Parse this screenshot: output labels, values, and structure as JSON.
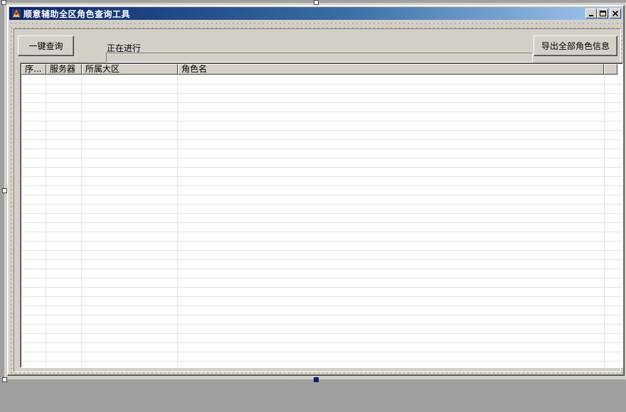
{
  "window": {
    "title": "顺意辅助全区角色查询工具",
    "app_icon": "wizard-app-icon",
    "controls": {
      "minimize": "0",
      "maximize": "1",
      "close": "r"
    }
  },
  "toolbar": {
    "query_button": "一键查询",
    "export_button": "导出全部角色信息",
    "progress_label": "正在进行",
    "progress_value": 0
  },
  "table": {
    "columns": [
      "序...",
      "服务器",
      "所属大区",
      "角色名",
      ""
    ],
    "rows": []
  },
  "colors": {
    "title_start": "#0a246a",
    "title_end": "#a6caf0",
    "face": "#d4d0c8"
  }
}
